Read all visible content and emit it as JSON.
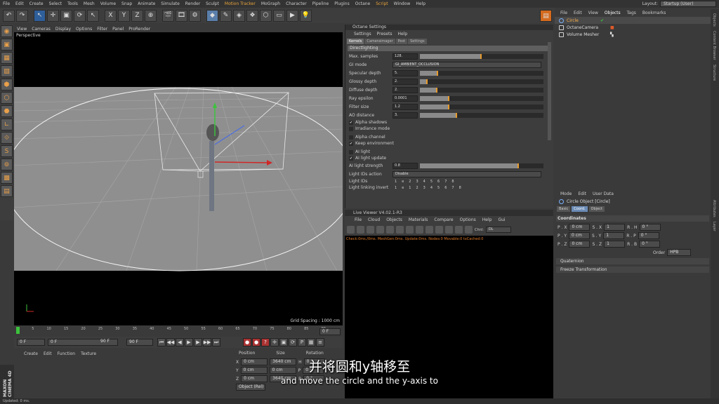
{
  "menubar": {
    "items": [
      "File",
      "Edit",
      "Create",
      "Select",
      "Tools",
      "Mesh",
      "Volume",
      "Snap",
      "Animate",
      "Simulate",
      "Render",
      "Sculpt",
      "Motion Tracker",
      "MoGraph",
      "Character",
      "Pipeline",
      "Plugins",
      "Octane",
      "Script",
      "Window",
      "Help"
    ],
    "layout_label": "Layout:",
    "layout_value": "Startup (User)"
  },
  "viewport": {
    "menu": [
      "View",
      "Cameras",
      "Display",
      "Options",
      "Filter",
      "Panel",
      "ProRender"
    ],
    "label": "Perspective",
    "grid_spacing": "Grid Spacing : 1000 cm"
  },
  "timeline": {
    "ticks": [
      "0",
      "5",
      "10",
      "15",
      "20",
      "25",
      "30",
      "35",
      "40",
      "45",
      "50",
      "55",
      "60",
      "65",
      "70",
      "75",
      "80",
      "85",
      "90"
    ],
    "end_field": "0 F",
    "start_frame": "0 F",
    "current_frame": "0 F",
    "end_frame_a": "90 F",
    "end_frame_b": "90 F"
  },
  "material": {
    "menu": [
      "Create",
      "Edit",
      "Function",
      "Texture"
    ]
  },
  "coords": {
    "headers": [
      "Position",
      "Size",
      "Rotation"
    ],
    "rows": [
      {
        "axis": "X",
        "pos": "0 cm",
        "size": "3640 cm",
        "rlabel": "H",
        "rot": "0 °"
      },
      {
        "axis": "Y",
        "pos": "0 cm",
        "size": "0 cm",
        "rlabel": "P",
        "rot": "0 °"
      },
      {
        "axis": "Z",
        "pos": "0 cm",
        "size": "3640 cm",
        "rlabel": "B",
        "rot": "0 °"
      }
    ],
    "mode": "Object (Rel)"
  },
  "brand": "MAXON CINEMA 4D",
  "status": "Updated: 0 ms.",
  "octane": {
    "title": "Octane Settings",
    "menu": [
      "Settings",
      "Presets",
      "Help"
    ],
    "tabs": [
      "Kernels",
      "Cameraimager",
      "Post",
      "Settings"
    ],
    "section": "Directlighting",
    "params": [
      {
        "label": "Max. samples",
        "value": "128.",
        "fill": 0.5
      },
      {
        "label": "Specular depth",
        "value": "5.",
        "fill": 0.15
      },
      {
        "label": "Glossy depth",
        "value": "2.",
        "fill": 0.06
      },
      {
        "label": "Diffuse depth",
        "value": "2.",
        "fill": 0.14
      },
      {
        "label": "Ray epsilon",
        "value": "0.0001",
        "fill": 0.24
      },
      {
        "label": "Filter size",
        "value": "1.2",
        "fill": 0.24
      },
      {
        "label": "AO distance",
        "value": "3.",
        "fill": 0.3
      }
    ],
    "gi_label": "GI mode",
    "gi_value": "GI_AMBIENT_OCCLUSION",
    "checks1": [
      {
        "label": "Alpha shadows",
        "on": "✔"
      },
      {
        "label": "Irradiance mode",
        "on": ""
      }
    ],
    "checks2": [
      {
        "label": "Alpha channel",
        "on": ""
      },
      {
        "label": "Keep environment",
        "on": "✔"
      }
    ],
    "checks3": [
      {
        "label": "AI light",
        "on": ""
      },
      {
        "label": "AI light update",
        "on": "✔"
      }
    ],
    "ai_strength_label": "AI light strength",
    "ai_strength_value": "0.8",
    "ai_strength_fill": 0.8,
    "light_ids_action_label": "Light IDs action",
    "light_ids_action_value": "Disable",
    "light_ids_label": "Light IDs",
    "light_ids": [
      "1",
      "e",
      "2",
      "3",
      "4",
      "5",
      "6",
      "7",
      "8"
    ],
    "light_link_label": "Light linking invert",
    "light_link": [
      "1",
      "e",
      "1",
      "2",
      "3",
      "4",
      "5",
      "6",
      "7",
      "8"
    ]
  },
  "live_viewer": {
    "title": "Live Viewer V4.02.1-R3",
    "menu": [
      "File",
      "Cloud",
      "Objects",
      "Materials",
      "Compare",
      "Options",
      "Help",
      "Gui"
    ],
    "channel_label": "Chnl:",
    "channel_value": "DL",
    "status": "Check:0ms./0ms.  MeshGen:0ms.  Update:0ms.  Nodes:0 Movable:0 txCached:0"
  },
  "objects": {
    "menu": [
      "File",
      "Edit",
      "View",
      "Objects",
      "Tags",
      "Bookmarks"
    ],
    "items": [
      "Circle",
      "OctaneCamera",
      "Volume Mesher"
    ]
  },
  "attributes": {
    "menu": [
      "Mode",
      "Edit",
      "User Data"
    ],
    "object_title": "Circle Object [Circle]",
    "tabs": [
      "Basic",
      "Coord.",
      "Object"
    ],
    "section": "Coordinates",
    "rows": [
      {
        "p": "P . X",
        "pv": "0 cm",
        "s": "S . X",
        "sv": "1",
        "r": "R . H",
        "rv": "0 °"
      },
      {
        "p": "P . Y",
        "pv": "0 cm",
        "s": "S . Y",
        "sv": "1",
        "r": "R . P",
        "rv": "0 °"
      },
      {
        "p": "P . Z",
        "pv": "0 cm",
        "s": "S . Z",
        "sv": "1",
        "r": "R . B",
        "rv": "0 °"
      }
    ],
    "order_label": "Order",
    "order_value": "HPB",
    "collapsed": [
      "Quaternion",
      "Freeze Transformation"
    ]
  },
  "right_tabs": [
    "Objects",
    "Content Browser",
    "Structure",
    "Attributes",
    "Layer"
  ],
  "subtitles": {
    "zh": "并将圆和y轴移至",
    "en": "and move the circle and the y-axis to"
  }
}
